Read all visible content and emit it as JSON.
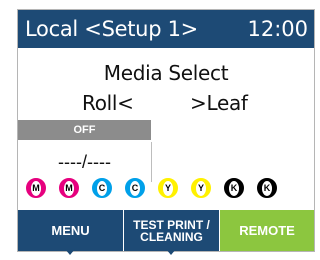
{
  "header": {
    "title": "Local <Setup 1>",
    "clock": "12:00"
  },
  "main": {
    "heading": "Media Select",
    "option_left": "Roll<",
    "option_right": ">Leaf"
  },
  "status": {
    "label": "OFF",
    "value": "----/----"
  },
  "inks": [
    {
      "letter": "M",
      "color": "#e6007e"
    },
    {
      "letter": "M",
      "color": "#e6007e"
    },
    {
      "letter": "C",
      "color": "#00a0e9"
    },
    {
      "letter": "C",
      "color": "#00a0e9"
    },
    {
      "letter": "Y",
      "color": "#fff100"
    },
    {
      "letter": "Y",
      "color": "#fff100"
    },
    {
      "letter": "K",
      "color": "#000000"
    },
    {
      "letter": "K",
      "color": "#000000"
    }
  ],
  "softkeys": {
    "menu": "MENU",
    "test_line1": "TEST PRINT /",
    "test_line2": "CLEANING",
    "remote": "REMOTE"
  },
  "colors": {
    "header_bg": "#1d4a75",
    "remote_bg": "#8cc63f",
    "status_bg": "#8c8c8c"
  }
}
